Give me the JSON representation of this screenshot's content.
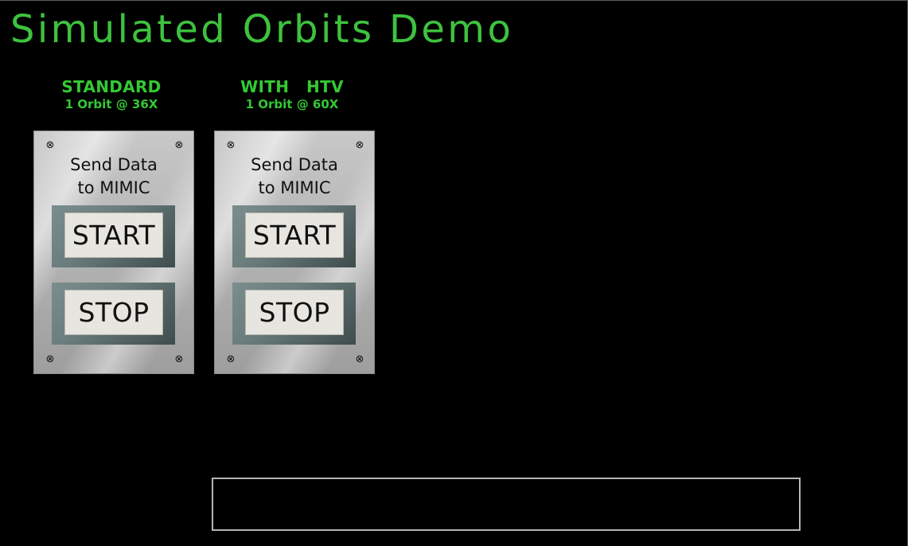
{
  "title": "Simulated Orbits Demo",
  "colors": {
    "background": "#000000",
    "title_green": "#3ec23e",
    "heading_green": "#34c934",
    "panel_metal": "#b4b4b4",
    "button_face": "#e7e5df",
    "message_border": "#b5b5b5"
  },
  "panels": [
    {
      "heading": "STANDARD",
      "subheading": "1 Orbit @ 36X",
      "label_line1": "Send Data",
      "label_line2": "to MIMIC",
      "start_label": "START",
      "stop_label": "STOP",
      "screw_icon": "screw-icon"
    },
    {
      "heading": "WITH   HTV",
      "subheading": "1 Orbit @ 60X",
      "label_line1": "Send Data",
      "label_line2": "to MIMIC",
      "start_label": "START",
      "stop_label": "STOP",
      "screw_icon": "screw-icon"
    }
  ],
  "message_box": {
    "text": ""
  }
}
